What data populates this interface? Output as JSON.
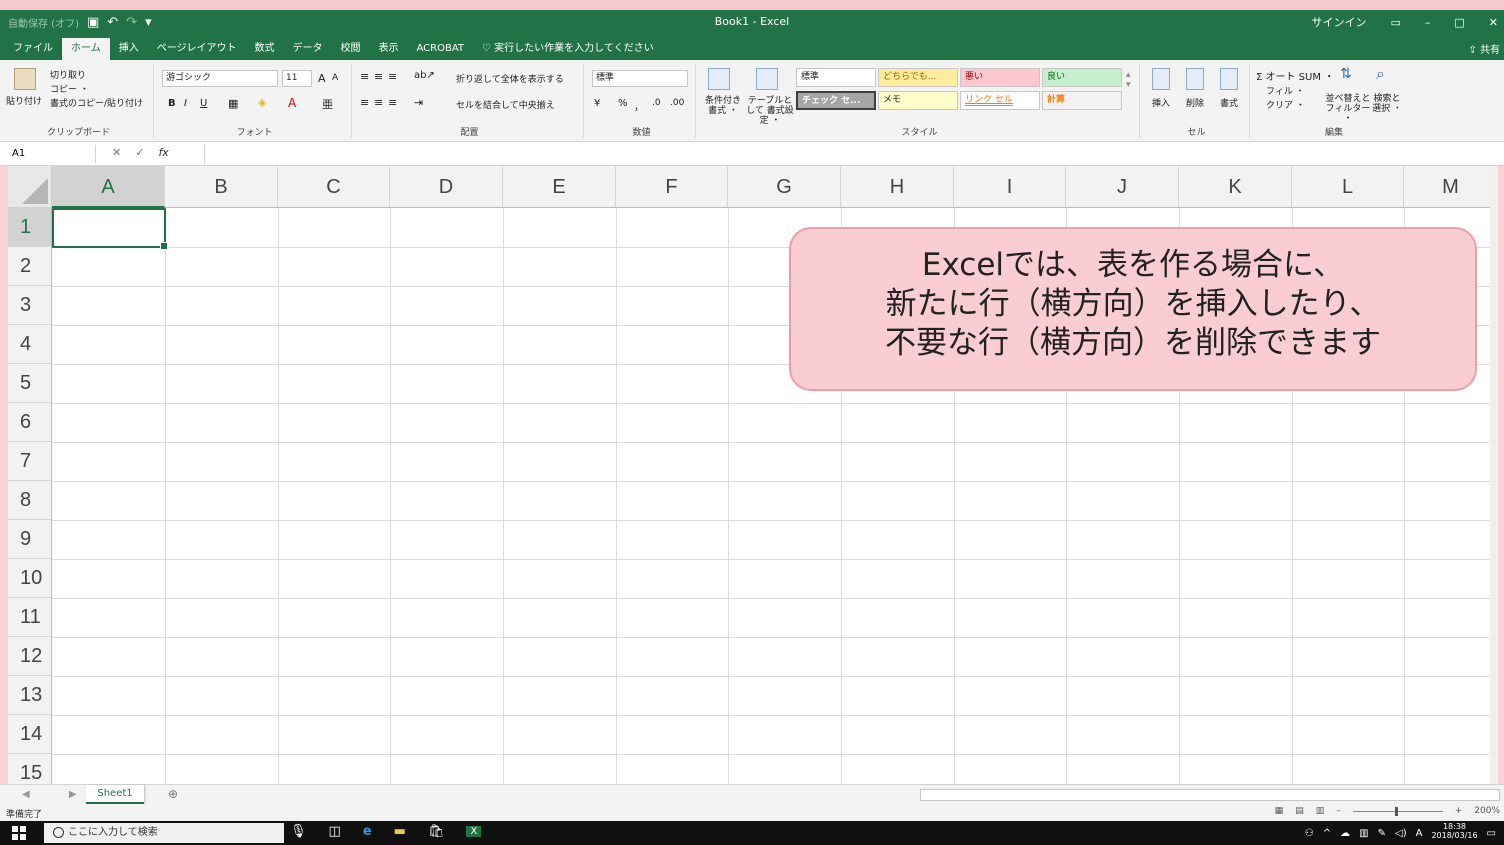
{
  "window": {
    "autosave": "自動保存 (オフ)",
    "title": "Book1 - Excel",
    "signin": "サインイン",
    "min_glyph": "–",
    "max_glyph": "□",
    "close_glyph": "✕",
    "save_glyph": "💾",
    "undo_glyph": "↶",
    "redo_glyph": "↷",
    "ribbon_opt_glyph": "▭"
  },
  "menu": {
    "tabs": [
      "ファイル",
      "ホーム",
      "挿入",
      "ページレイアウト",
      "数式",
      "データ",
      "校閲",
      "表示",
      "ACROBAT"
    ],
    "tell_me": "実行したい作業を入力してください",
    "share": "共有"
  },
  "ribbon": {
    "clipboard": {
      "paste": "貼り付け",
      "cut": "切り取り",
      "copy": "コピー ・",
      "format_painter": "書式のコピー/貼り付け",
      "label": "クリップボード"
    },
    "font": {
      "name": "游ゴシック",
      "size": "11",
      "bold": "B",
      "italic": "I",
      "underline": "U",
      "grow": "A",
      "shrink": "A",
      "label": "フォント"
    },
    "alignment": {
      "wrap": "折り返して全体を表示する",
      "merge": "セルを結合して中央揃え",
      "label": "配置"
    },
    "number": {
      "format": "標準",
      "percent": "%",
      "comma": "，",
      "label": "数値"
    },
    "styles": {
      "conditional": "条件付き 書式 ・",
      "table": "テーブルとして 書式設定 ・",
      "cells": [
        "標準",
        "どちらでも...",
        "悪い",
        "良い",
        "チェック セ...",
        "メモ",
        "リンク セル",
        "計算"
      ],
      "label": "スタイル"
    },
    "cells_group": {
      "insert": "挿入",
      "delete": "削除",
      "format": "書式",
      "label": "セル"
    },
    "editing": {
      "autosum": "Σ オート SUM ・",
      "fill": "フィル ・",
      "clear": "クリア ・",
      "sort": "並べ替えと フィルター ・",
      "find": "検索と 選択 ・",
      "label": "編集"
    }
  },
  "formula_bar": {
    "name_box": "A1",
    "cancel": "✕",
    "enter": "✓",
    "fx": "fx",
    "value": ""
  },
  "grid": {
    "columns": [
      "A",
      "B",
      "C",
      "D",
      "E",
      "F",
      "G",
      "H",
      "I",
      "J",
      "K",
      "L",
      "M"
    ],
    "rows": [
      "1",
      "2",
      "3",
      "4",
      "5",
      "6",
      "7",
      "8",
      "9",
      "10",
      "11",
      "12",
      "13",
      "14",
      "15"
    ],
    "selected_cell": "A1"
  },
  "callout": {
    "line1": "Excelでは、表を作る場合に、",
    "line2": "新たに行（横方向）を挿入したり、",
    "line3": "不要な行（横方向）を削除できます"
  },
  "sheets": {
    "tabs": [
      "Sheet1"
    ],
    "add": "⊕",
    "nav": "◀ ▶"
  },
  "status": {
    "text": "準備完了",
    "zoom": "200%"
  },
  "taskbar": {
    "search_placeholder": "ここに入力して検索",
    "ime": "A",
    "time": "18:38",
    "date": "2018/03/16"
  }
}
